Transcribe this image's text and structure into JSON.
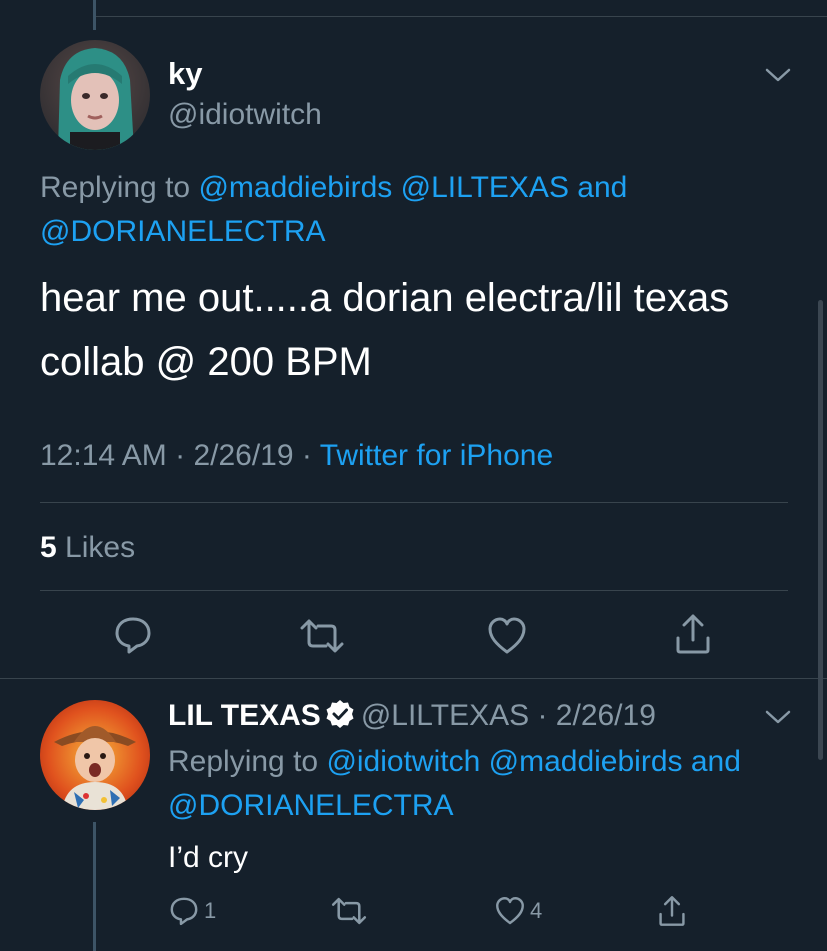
{
  "tweet": {
    "display_name": "ky",
    "handle": "@idiotwitch",
    "replying_prefix": "Replying to",
    "replying_user1": "@maddiebirds",
    "replying_user2": "@LILTEXAS",
    "replying_and": "and",
    "replying_user3": "@DORIANELECTRA",
    "text_line1": "hear me out.....a dorian electra/lil texas",
    "text_line2": "collab @ 200 BPM",
    "time": "12:14 AM",
    "date": "2/26/19",
    "separator": "·",
    "source": "Twitter for iPhone",
    "likes_count": "5",
    "likes_label": "Likes"
  },
  "reply": {
    "display_name": "LIL TEXAS",
    "handle": "@LILTEXAS",
    "separator": "·",
    "date": "2/26/19",
    "replying_prefix": "Replying to",
    "replying_user1": "@idiotwitch",
    "replying_user2": "@maddiebirds",
    "replying_and": "and",
    "replying_user3": "@DORIANELECTRA",
    "text": "I’d cry",
    "reply_count": "1",
    "like_count": "4"
  },
  "icons": [
    "chevron-down-icon",
    "comment-icon",
    "retweet-icon",
    "heart-icon",
    "share-icon",
    "verified-badge-icon"
  ],
  "colors": {
    "background": "#15202b",
    "link": "#1da1f2",
    "muted": "#8899a6",
    "divider": "#38444d"
  }
}
